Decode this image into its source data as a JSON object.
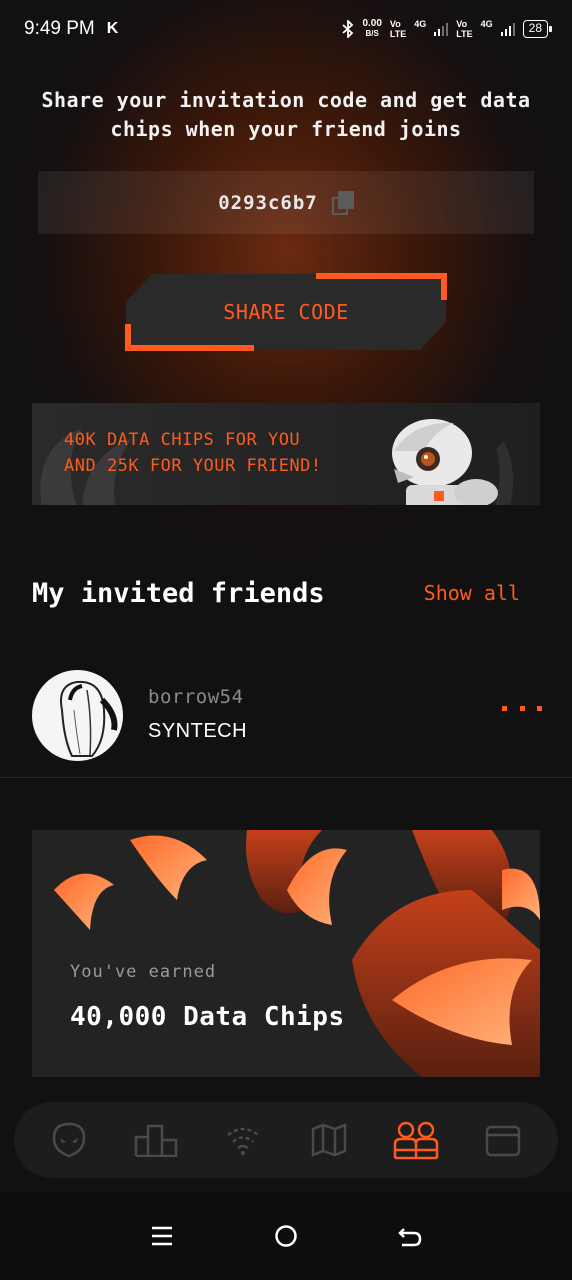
{
  "status_bar": {
    "time": "9:49 PM",
    "app_indicator": "K",
    "net_speed_value": "0.00",
    "net_speed_unit": "B/S",
    "sim1_label": "Vo\nLTE",
    "sim1_tech": "4G",
    "sim2_label": "Vo\nLTE",
    "sim2_tech": "4G",
    "battery": "28"
  },
  "invite": {
    "message": "Share your invitation code and get data chips when your friend joins",
    "code": "0293c6b7",
    "share_label": "SHARE CODE"
  },
  "promo": {
    "line1": "40K DATA CHIPS FOR YOU",
    "line2": "AND 25K FOR YOUR FRIEND!"
  },
  "friends": {
    "title": "My invited friends",
    "show_all": "Show all",
    "items": [
      {
        "username": "borrow54",
        "org": "SYNTECH"
      }
    ]
  },
  "earned": {
    "label": "You've earned",
    "amount": "40,000 Data Chips"
  },
  "tabs": [
    {
      "icon": "alien-head-icon",
      "active": false
    },
    {
      "icon": "bar-chart-icon",
      "active": false
    },
    {
      "icon": "wifi-icon",
      "active": false
    },
    {
      "icon": "map-icon",
      "active": false
    },
    {
      "icon": "friends-icon",
      "active": true
    },
    {
      "icon": "wallet-icon",
      "active": false
    }
  ],
  "colors": {
    "accent": "#ff5a1f",
    "background": "#111111",
    "tab_inactive": "#4a4a4a"
  }
}
